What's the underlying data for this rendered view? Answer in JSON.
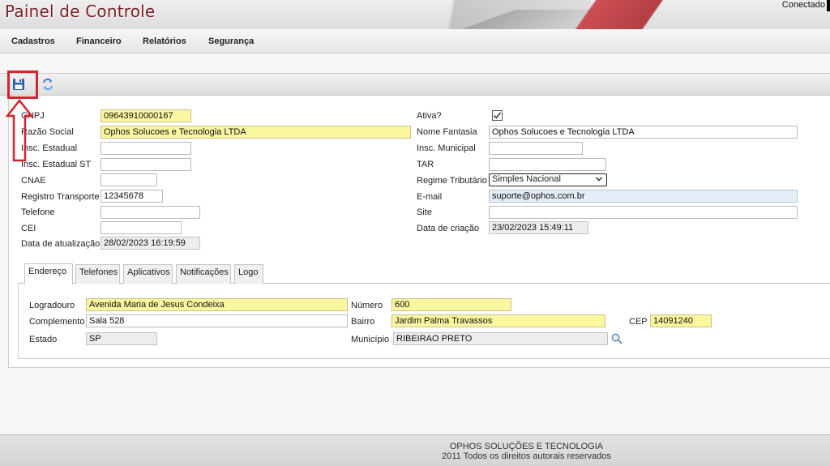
{
  "header": {
    "title": "Painel de Controle",
    "connection_status": "Conectado"
  },
  "menu": {
    "items": [
      "Cadastros",
      "Financeiro",
      "Relatórios",
      "Segurança"
    ]
  },
  "toolbar": {
    "save_icon": "floppy-disk-icon",
    "refresh_icon": "refresh-icon"
  },
  "form": {
    "cnpj": {
      "label": "CNPJ",
      "value": "09643910000167"
    },
    "razao_social": {
      "label": "Razão Social",
      "value": "Ophos Solucoes e Tecnologia LTDA"
    },
    "insc_estadual": {
      "label": "Insc. Estadual",
      "value": ""
    },
    "insc_estadual_st": {
      "label": "Insc. Estadual ST",
      "value": ""
    },
    "cnae": {
      "label": "CNAE",
      "value": ""
    },
    "registro_transporte": {
      "label": "Registro Transporte",
      "value": "12345678"
    },
    "telefone": {
      "label": "Telefone",
      "value": ""
    },
    "cei": {
      "label": "CEI",
      "value": ""
    },
    "data_atualizacao": {
      "label": "Data de atualização",
      "value": "28/02/2023 16:19:59"
    },
    "ativa": {
      "label": "Ativa?",
      "checked": true
    },
    "nome_fantasia": {
      "label": "Nome Fantasia",
      "value": "Ophos Solucoes e Tecnologia LTDA"
    },
    "insc_municipal": {
      "label": "Insc. Municipal",
      "value": ""
    },
    "tar": {
      "label": "TAR",
      "value": ""
    },
    "regime_tributario": {
      "label": "Regime Tributário",
      "value": "Simples Nacional"
    },
    "email": {
      "label": "E-mail",
      "value": "suporte@ophos.com.br"
    },
    "site": {
      "label": "Site",
      "value": ""
    },
    "data_criacao": {
      "label": "Data de criação",
      "value": "23/02/2023 15:49:11"
    }
  },
  "tabs": {
    "items": [
      "Endereço",
      "Telefones",
      "Aplicativos",
      "Notificações",
      "Logo"
    ],
    "active": "Endereço"
  },
  "endereco": {
    "logradouro": {
      "label": "Logradouro",
      "value": "Avenida Maria de Jesus Condeixa"
    },
    "numero": {
      "label": "Número",
      "value": "600"
    },
    "complemento": {
      "label": "Complemento",
      "value": "Sala 528"
    },
    "bairro": {
      "label": "Bairro",
      "value": "Jardim Palma Travassos"
    },
    "cep": {
      "label": "CEP",
      "value": "14091240"
    },
    "estado": {
      "label": "Estado",
      "value": "SP"
    },
    "municipio": {
      "label": "Município",
      "value": "RIBEIRAO PRETO"
    }
  },
  "footer": {
    "company": "OPHOS SOLUÇÕES E TECNOLOGIA",
    "copyright": "2011 Todos os direitos autorais reservados"
  },
  "colors": {
    "brand": "#7a1f24",
    "required_field": "#fbf6a0",
    "annotation": "#d0262d",
    "email_field": "#e4edf8"
  }
}
